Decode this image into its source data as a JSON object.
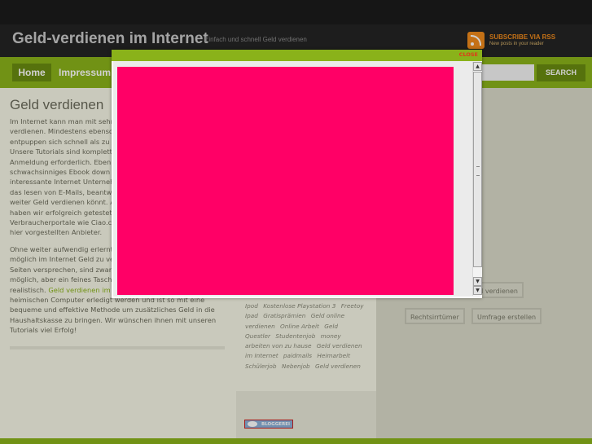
{
  "header": {
    "title": "Geld-verdienen im Internet",
    "tagline": "Einfach und schnell Geld verdienen",
    "rss_title": "SUBSCRIBE VIA RSS",
    "rss_subtitle": "New posts in your reader"
  },
  "nav": {
    "home": "Home",
    "impressum": "Impressum",
    "search_button": "SEARCH",
    "search_value": ""
  },
  "post": {
    "title_visible": "Geld verdienen",
    "para1_lines": [
      "Im Internet kann man mit sehr",
      "verdienen. Mindestens ebenso",
      "entpuppen sich schnell als zu",
      "Unsere Tutorials sind komplett",
      "Anmeldung erforderlich. Eben",
      "schwachsinniges Ebook down",
      "interessante Internet Unterneh",
      "das lesen von E-Mails, beantw",
      "weiter Geld verdienen könnt. A",
      "haben wir erfolgreich getestet",
      "Verbraucherportale wie Ciao.c",
      "hier vorgestellten Anbieter."
    ],
    "para2_lines": [
      "Ohne weiter aufwendig erlernt",
      "möglich im Internet Geld zu ve",
      "Seiten versprechen, sind zwar",
      "möglich, aber ein feines Tasch"
    ],
    "para2_link_prefix": "realistisch. ",
    "para2_link": "Geld verdienen im",
    "para2_tail_lines": [
      "heimischen Computer erledigt werden und ist so mit eine",
      "bequeme und effektive Methode um zusätzliches Geld in die",
      "Haushaltskasse zu bringen. Wir wünschen ihnen mit unseren",
      "Tutorials viel Erfolg!"
    ]
  },
  "tags": [
    "Ipod",
    "Kostenlose Playstation 3",
    "Freetoy",
    "Ipad",
    "Gratisprämien",
    "Geld online verdienen",
    "Online Arbeit",
    "Geld Questler",
    "Studentenjob",
    "money arbeiten von zu hause",
    "Geld verdienen im Internet",
    "paidmails",
    "Heimarbeit",
    "Schülerjob",
    "Nebenjob",
    "Geld verdienen"
  ],
  "right_tags": {
    "partial": "ld verdienen",
    "rechtsirrtuemer": "Rechtsirrtümer",
    "umfrage": "Umfrage erstellen"
  },
  "badge": {
    "label": "BLOGGEREI"
  },
  "modal": {
    "close_label": "CLOSE",
    "content_color": "#ff0066",
    "scroll_up": "▲",
    "scroll_down": "▼",
    "scroll_down2": "▼"
  },
  "colors": {
    "accent_green": "#8ab21a",
    "header_dark": "#242424",
    "rss_orange": "#f08a1c",
    "modal_pink": "#ff0066"
  }
}
